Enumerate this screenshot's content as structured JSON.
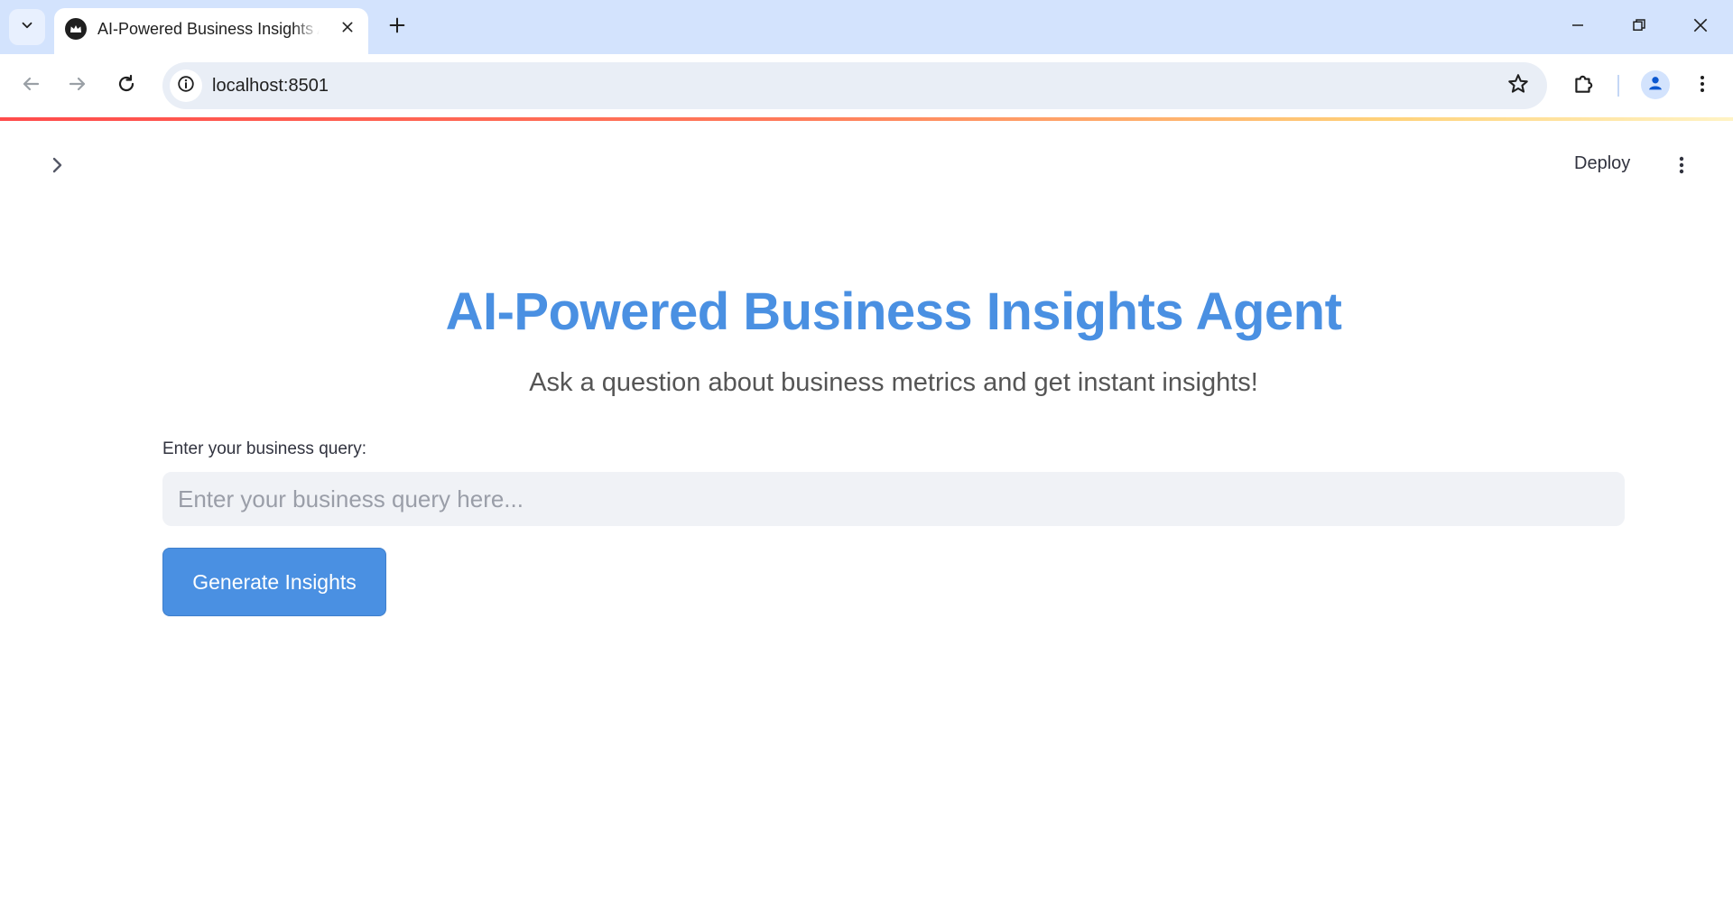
{
  "browser": {
    "tab": {
      "title": "AI-Powered Business Insights Agent"
    },
    "address_bar": {
      "url": "localhost:8501"
    }
  },
  "app": {
    "header": {
      "deploy_label": "Deploy"
    },
    "title": "AI-Powered Business Insights Agent",
    "subtitle": "Ask a question about business metrics and get instant insights!",
    "query": {
      "label": "Enter your business query:",
      "placeholder": "Enter your business query here...",
      "value": ""
    },
    "generate_button_label": "Generate Insights"
  },
  "colors": {
    "accent": "#4a90e2",
    "tabbar": "#d3e3fd",
    "input_bg": "#f0f2f6"
  },
  "icons": {
    "tab_search": "chevron-down-icon",
    "favicon": "streamlit-crown-icon",
    "tab_close": "close-icon",
    "new_tab": "plus-icon",
    "back": "arrow-left-icon",
    "forward": "arrow-right-icon",
    "reload": "reload-icon",
    "site_info": "info-icon",
    "bookmark": "star-icon",
    "extensions": "puzzle-icon",
    "profile": "person-icon",
    "browser_menu": "kebab-menu-icon",
    "sidebar_toggle": "chevron-right-icon",
    "app_menu": "kebab-menu-icon"
  }
}
